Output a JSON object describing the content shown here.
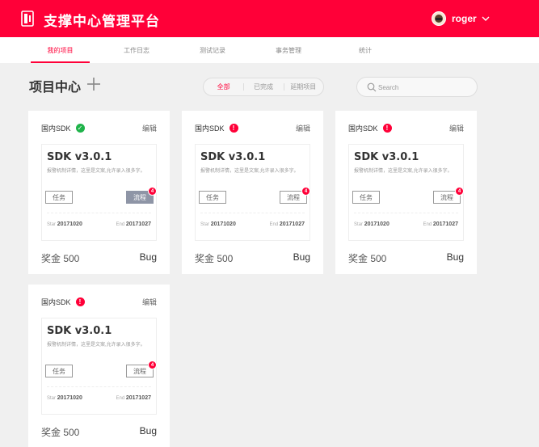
{
  "app": {
    "title": "支撑中心管理平台"
  },
  "user": {
    "name": "roger"
  },
  "nav": {
    "tabs": [
      {
        "label": "我的项目"
      },
      {
        "label": "工作日志"
      },
      {
        "label": "测试记录"
      },
      {
        "label": "事务管理"
      },
      {
        "label": "统计"
      }
    ]
  },
  "page": {
    "title": "项目中心"
  },
  "filter": {
    "options": [
      "全部",
      "已完成",
      "延期项目"
    ],
    "selected": "全部"
  },
  "search": {
    "placeholder": "Search"
  },
  "colors": {
    "brand": "#ff0038",
    "ok": "#1fb34a",
    "flow_filled": "#8e95a6"
  },
  "cards": [
    {
      "category": "国内SDK",
      "status": "ok",
      "status_icon": "check-circle-icon",
      "edit": "编辑",
      "title": "SDK v3.0.1",
      "desc": "报警机制详情，这里是文案,允许录入很多字。",
      "task": "任务",
      "flow": "流程",
      "flow_filled": true,
      "badge": "4",
      "start_label": "Star",
      "start": "20171020",
      "end_label": "End",
      "end": "20171027",
      "reward": "奖金 500",
      "type": "Bug"
    },
    {
      "category": "国内SDK",
      "status": "warn",
      "status_icon": "alert-circle-icon",
      "edit": "编辑",
      "title": "SDK v3.0.1",
      "desc": "报警机制详情，这里是文案,允许录入很多字。",
      "task": "任务",
      "flow": "流程",
      "flow_filled": false,
      "badge": "4",
      "start_label": "Star",
      "start": "20171020",
      "end_label": "End",
      "end": "20171027",
      "reward": "奖金 500",
      "type": "Bug"
    },
    {
      "category": "国内SDK",
      "status": "warn",
      "status_icon": "alert-circle-icon",
      "edit": "编辑",
      "title": "SDK v3.0.1",
      "desc": "报警机制详情，这里是文案,允许录入很多字。",
      "task": "任务",
      "flow": "流程",
      "flow_filled": false,
      "badge": "4",
      "start_label": "Star",
      "start": "20171020",
      "end_label": "End",
      "end": "20171027",
      "reward": "奖金 500",
      "type": "Bug"
    },
    {
      "category": "国内SDK",
      "status": "warn",
      "status_icon": "alert-circle-icon",
      "edit": "编辑",
      "title": "SDK v3.0.1",
      "desc": "报警机制详情，这里是文案,允许录入很多字。",
      "task": "任务",
      "flow": "流程",
      "flow_filled": false,
      "badge": "4",
      "start_label": "Star",
      "start": "20171020",
      "end_label": "End",
      "end": "20171027",
      "reward": "奖金 500",
      "type": "Bug"
    }
  ]
}
